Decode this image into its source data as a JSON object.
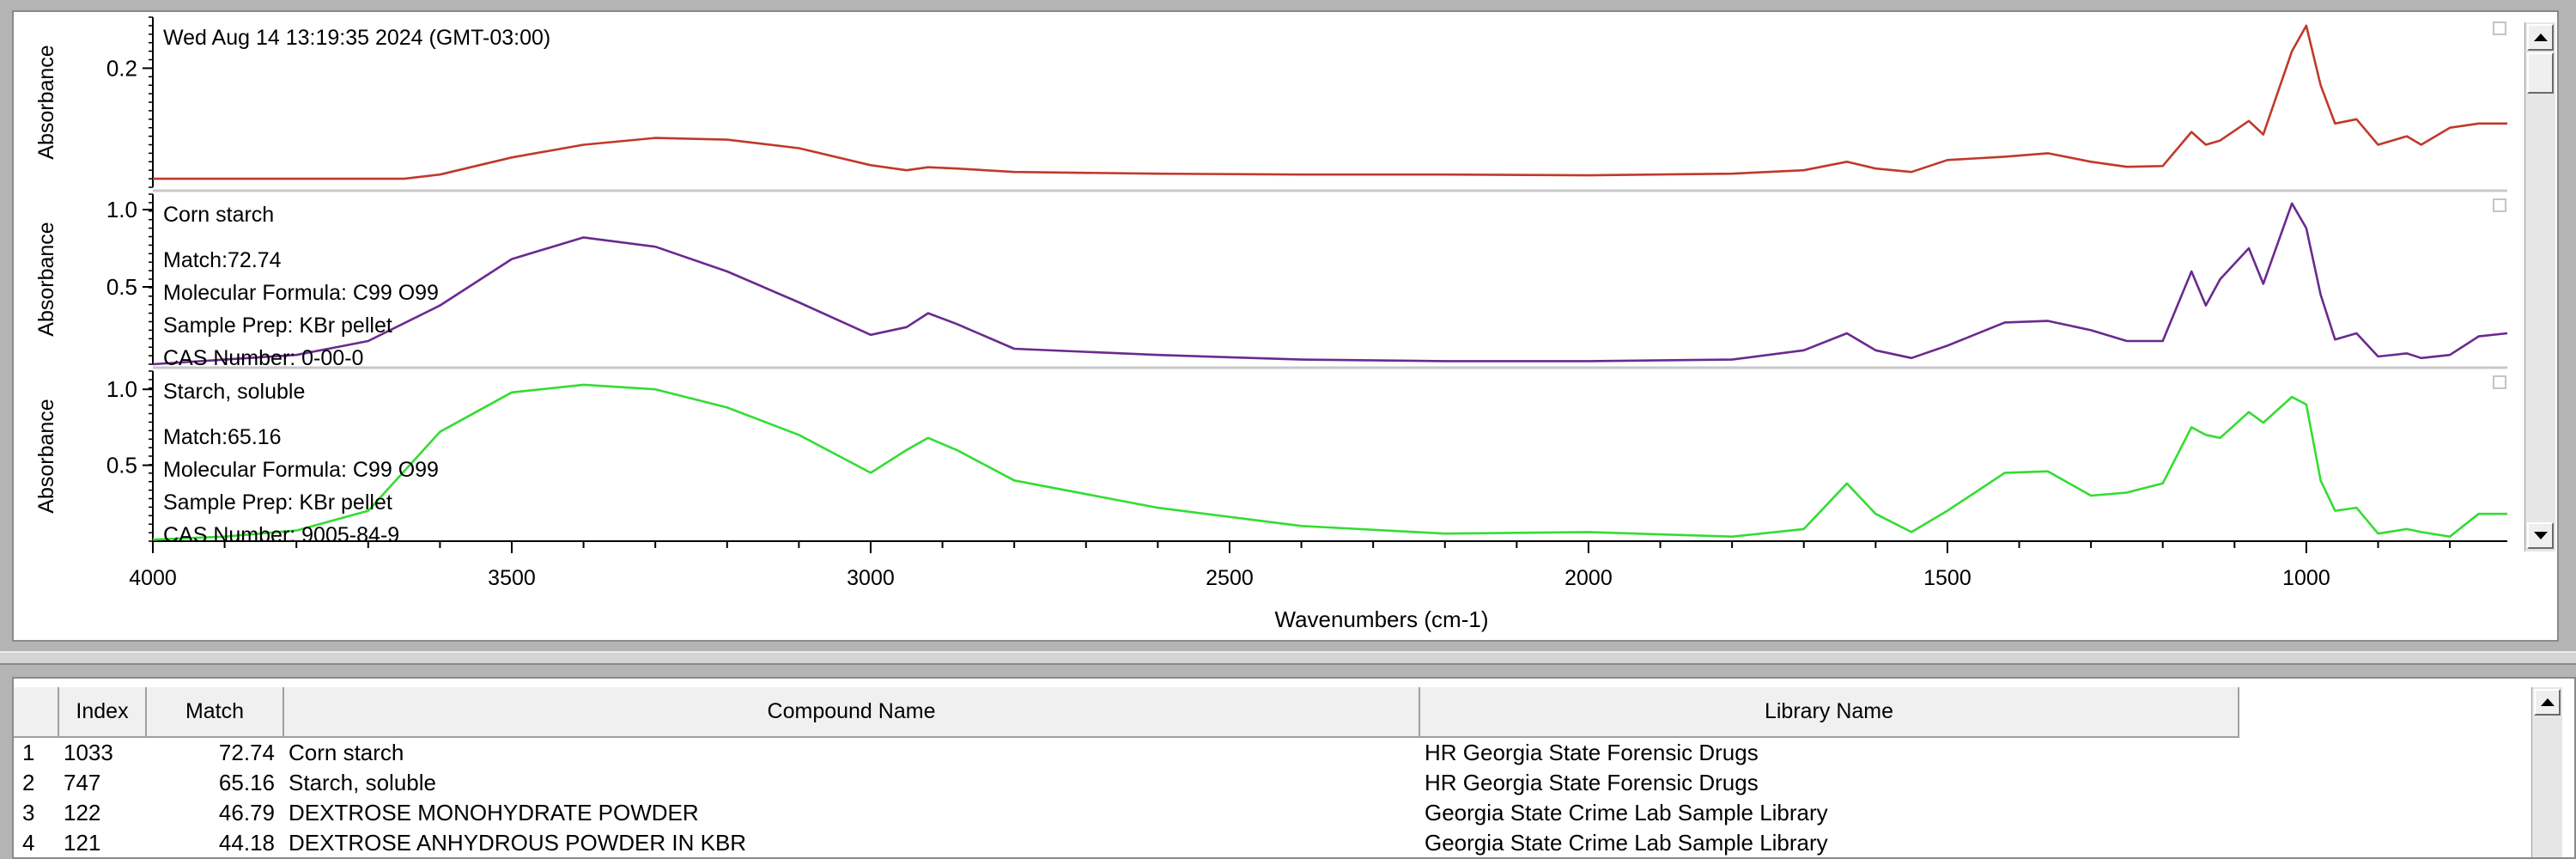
{
  "timestamp": "Wed Aug 14 13:19:35 2024 (GMT-03:00)",
  "ylabel": "Absorbance",
  "xlabel": "Wavenumbers (cm-1)",
  "panels": [
    {
      "id": "sample",
      "color": "#c0392b",
      "ticks": [
        "0.2"
      ],
      "info": [
        "Wed Aug 14 13:19:35 2024 (GMT-03:00)"
      ]
    },
    {
      "id": "corn-starch",
      "color": "#6a2a8e",
      "ticks": [
        "1.0",
        "0.5"
      ],
      "info": [
        "Corn starch",
        "Match:72.74",
        "Molecular Formula:  C99 O99",
        "Sample Prep:  KBr pellet",
        "CAS Number:  0-00-0"
      ]
    },
    {
      "id": "starch-soluble",
      "color": "#33dd33",
      "ticks": [
        "1.0",
        "0.5"
      ],
      "info": [
        "Starch, soluble",
        "Match:65.16",
        "Molecular Formula:  C99 O99",
        "Sample Prep:  KBr pellet",
        "CAS Number:  9005-84-9"
      ]
    }
  ],
  "x_ticks": [
    "4000",
    "3500",
    "3000",
    "2500",
    "2000",
    "1500",
    "1000"
  ],
  "table": {
    "headers": [
      "Index",
      "Match",
      "Compound Name",
      "Library Name"
    ],
    "rows": [
      {
        "n": "1",
        "index": "1033",
        "match": "72.74",
        "compound": "Corn starch",
        "library": "HR Georgia State Forensic Drugs"
      },
      {
        "n": "2",
        "index": "747",
        "match": "65.16",
        "compound": "Starch, soluble",
        "library": "HR Georgia State Forensic Drugs"
      },
      {
        "n": "3",
        "index": "122",
        "match": "46.79",
        "compound": "DEXTROSE MONOHYDRATE POWDER",
        "library": "Georgia State Crime Lab Sample Library"
      },
      {
        "n": "4",
        "index": "121",
        "match": "44.18",
        "compound": "DEXTROSE ANHYDROUS POWDER IN KBR",
        "library": "Georgia State Crime Lab Sample Library"
      }
    ]
  },
  "chart_data": {
    "type": "line",
    "title": "",
    "xlabel": "Wavenumbers (cm-1)",
    "ylabel": "Absorbance",
    "xlim": [
      4000,
      720
    ],
    "grid": false,
    "series": [
      {
        "name": "Wed Aug 14 13:19:35 2024 (GMT-03:00)",
        "ylim": [
          0.06,
          0.26
        ],
        "x": [
          4000,
          3800,
          3650,
          3600,
          3500,
          3400,
          3300,
          3200,
          3100,
          3000,
          2950,
          2920,
          2880,
          2800,
          2600,
          2400,
          2200,
          2000,
          1800,
          1700,
          1640,
          1600,
          1550,
          1500,
          1420,
          1360,
          1300,
          1250,
          1200,
          1160,
          1140,
          1120,
          1080,
          1060,
          1020,
          1000,
          980,
          960,
          930,
          900,
          860,
          840,
          800,
          760,
          720
        ],
        "y": [
          0.07,
          0.07,
          0.07,
          0.075,
          0.095,
          0.11,
          0.118,
          0.116,
          0.106,
          0.086,
          0.08,
          0.0835,
          0.082,
          0.078,
          0.076,
          0.075,
          0.075,
          0.074,
          0.076,
          0.08,
          0.09,
          0.082,
          0.078,
          0.092,
          0.096,
          0.1,
          0.09,
          0.084,
          0.085,
          0.125,
          0.11,
          0.115,
          0.138,
          0.122,
          0.22,
          0.25,
          0.18,
          0.135,
          0.14,
          0.11,
          0.12,
          0.11,
          0.13,
          0.135,
          0.135
        ]
      },
      {
        "name": "Corn starch",
        "ylim": [
          0.0,
          1.1
        ],
        "x": [
          4000,
          3900,
          3800,
          3700,
          3600,
          3500,
          3400,
          3300,
          3200,
          3100,
          3000,
          2950,
          2920,
          2880,
          2800,
          2600,
          2400,
          2200,
          2000,
          1800,
          1700,
          1640,
          1600,
          1550,
          1500,
          1420,
          1360,
          1300,
          1250,
          1200,
          1160,
          1140,
          1120,
          1080,
          1060,
          1020,
          1000,
          980,
          960,
          930,
          900,
          860,
          840,
          800,
          760,
          720
        ],
        "y": [
          0.0,
          0.03,
          0.06,
          0.15,
          0.38,
          0.68,
          0.82,
          0.76,
          0.6,
          0.4,
          0.19,
          0.24,
          0.33,
          0.26,
          0.1,
          0.06,
          0.03,
          0.02,
          0.02,
          0.03,
          0.09,
          0.2,
          0.09,
          0.04,
          0.12,
          0.27,
          0.28,
          0.22,
          0.15,
          0.15,
          0.6,
          0.38,
          0.55,
          0.75,
          0.52,
          1.04,
          0.88,
          0.45,
          0.16,
          0.2,
          0.05,
          0.07,
          0.04,
          0.06,
          0.18,
          0.2
        ]
      },
      {
        "name": "Starch, soluble",
        "ylim": [
          0.0,
          1.12
        ],
        "x": [
          4000,
          3900,
          3800,
          3700,
          3600,
          3500,
          3400,
          3300,
          3200,
          3100,
          3000,
          2950,
          2920,
          2880,
          2800,
          2600,
          2400,
          2200,
          2000,
          1800,
          1700,
          1640,
          1600,
          1550,
          1500,
          1420,
          1360,
          1300,
          1250,
          1200,
          1160,
          1140,
          1120,
          1080,
          1060,
          1020,
          1000,
          980,
          960,
          930,
          900,
          860,
          840,
          800,
          760,
          720
        ],
        "y": [
          0.01,
          0.03,
          0.07,
          0.2,
          0.72,
          0.98,
          1.03,
          1.0,
          0.88,
          0.7,
          0.45,
          0.6,
          0.68,
          0.6,
          0.4,
          0.22,
          0.1,
          0.05,
          0.06,
          0.03,
          0.08,
          0.38,
          0.18,
          0.06,
          0.2,
          0.45,
          0.46,
          0.3,
          0.32,
          0.38,
          0.75,
          0.7,
          0.68,
          0.85,
          0.78,
          0.95,
          0.9,
          0.4,
          0.2,
          0.22,
          0.05,
          0.08,
          0.06,
          0.03,
          0.18,
          0.18
        ]
      }
    ]
  }
}
